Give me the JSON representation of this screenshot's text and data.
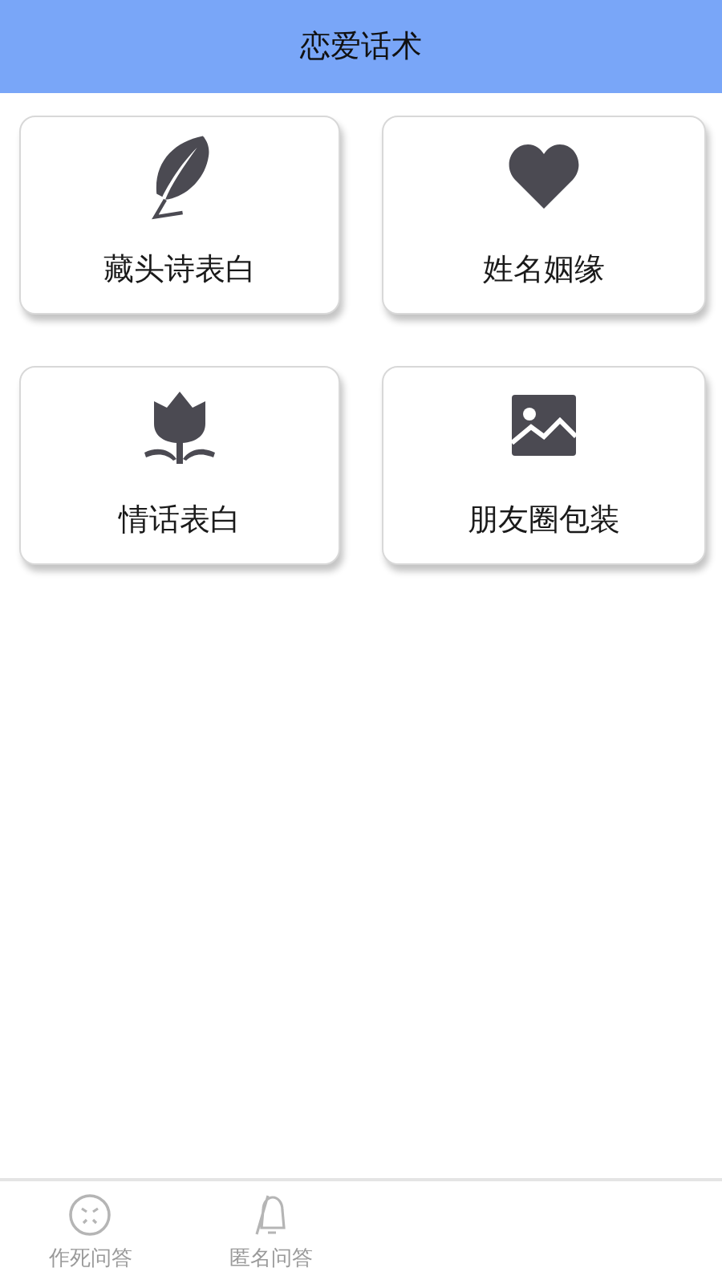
{
  "header": {
    "title": "恋爱话术"
  },
  "cards": [
    {
      "kind": "feather",
      "label": "藏头诗表白"
    },
    {
      "kind": "heart",
      "label": "姓名姻缘"
    },
    {
      "kind": "tulip",
      "label": "情话表白"
    },
    {
      "kind": "image",
      "label": "朋友圈包装"
    }
  ],
  "tab_bar": [
    {
      "kind": "sad",
      "label": "作死问答"
    },
    {
      "kind": "bell",
      "label": "匿名问答"
    }
  ]
}
